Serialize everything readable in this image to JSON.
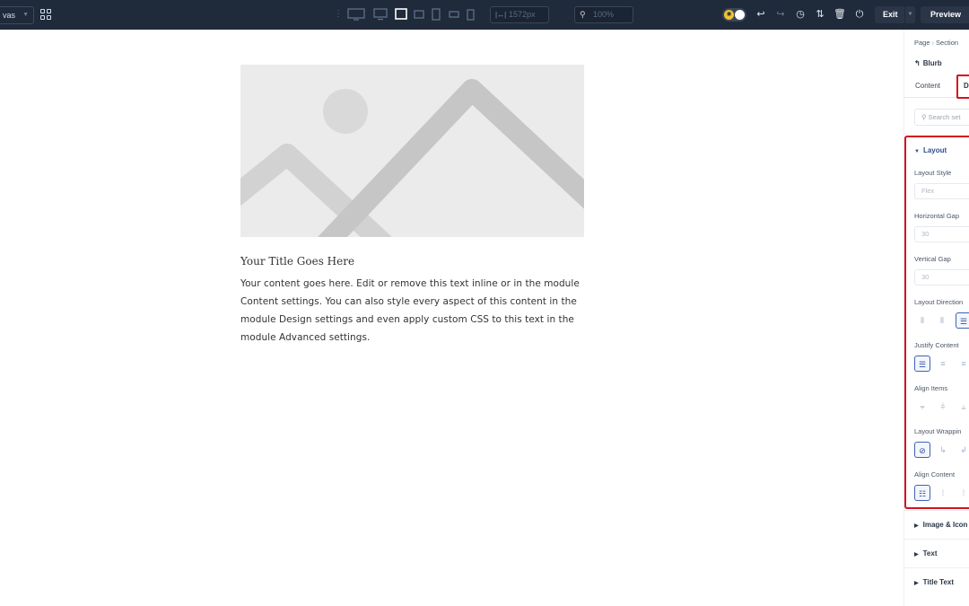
{
  "topbar": {
    "canvas_label": "vas",
    "width_value": "1572px",
    "zoom_value": "100%",
    "exit_label": "Exit",
    "preview_label": "Preview",
    "icons": [
      "grid-icon",
      "desktop-icon",
      "laptop-icon",
      "tablet-landscape-icon",
      "tablet-icon",
      "phone-landscape-icon",
      "phone-icon",
      "width-icon",
      "zoom-icon",
      "theme-toggle",
      "undo-icon",
      "redo-icon",
      "history-icon",
      "sort-icon",
      "trash-icon",
      "power-icon"
    ]
  },
  "canvas": {
    "title": "Your Title Goes Here",
    "body": "Your content goes here. Edit or remove this text inline or in the module Content settings. You can also style every aspect of this content in the module Design settings and even apply custom CSS to this text in the module Advanced settings."
  },
  "panel": {
    "breadcrumb": [
      "Page",
      "Section"
    ],
    "module_title": "Blurb",
    "tabs": {
      "content": "Content",
      "design": "Des"
    },
    "search_placeholder": "Search set",
    "layout": {
      "heading": "Layout",
      "layout_style_label": "Layout Style",
      "layout_style_value": "Flex",
      "horizontal_gap_label": "Horizontal Gap",
      "horizontal_gap_value": "30",
      "vertical_gap_label": "Vertical Gap",
      "vertical_gap_value": "30",
      "layout_direction_label": "Layout Direction",
      "justify_content_label": "Justify Content",
      "align_items_label": "Align Items",
      "layout_wrapping_label": "Layout Wrappin",
      "align_content_label": "Align Content"
    },
    "collapsed_sections": [
      "Image & Icon",
      "Text",
      "Title Text"
    ]
  },
  "colors": {
    "topbar_bg": "#1f2a3a",
    "highlight": "#d3131e",
    "accent": "#2f4f8f"
  }
}
